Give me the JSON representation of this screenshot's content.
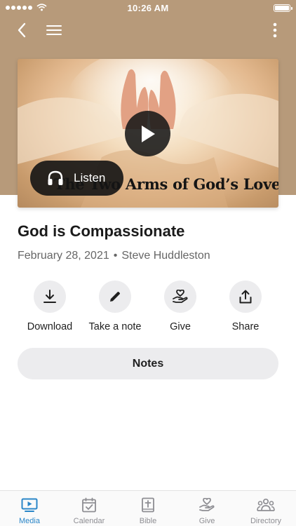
{
  "status_bar": {
    "time": "10:26 AM"
  },
  "hero": {
    "title_overlay": "The Two Arms of God’s Love",
    "listen_label": "Listen"
  },
  "sermon": {
    "title": "God is Compassionate",
    "date": "February 28, 2021",
    "separator": "•",
    "speaker": "Steve Huddleston"
  },
  "actions": [
    {
      "label": "Download",
      "icon": "download-icon"
    },
    {
      "label": "Take a note",
      "icon": "pencil-icon"
    },
    {
      "label": "Give",
      "icon": "heart-hand-icon"
    },
    {
      "label": "Share",
      "icon": "share-icon"
    }
  ],
  "notes_label": "Notes",
  "tabs": [
    {
      "label": "Media",
      "icon": "media-icon",
      "active": true
    },
    {
      "label": "Calendar",
      "icon": "calendar-icon",
      "active": false
    },
    {
      "label": "Bible",
      "icon": "bible-icon",
      "active": false
    },
    {
      "label": "Give",
      "icon": "heart-hand-icon",
      "active": false
    },
    {
      "label": "Directory",
      "icon": "people-icon",
      "active": false
    }
  ],
  "colors": {
    "header": "#b79a7a",
    "accent": "#2a86c8",
    "tab_inactive": "#8e8e93",
    "button_bg": "#ececee"
  }
}
